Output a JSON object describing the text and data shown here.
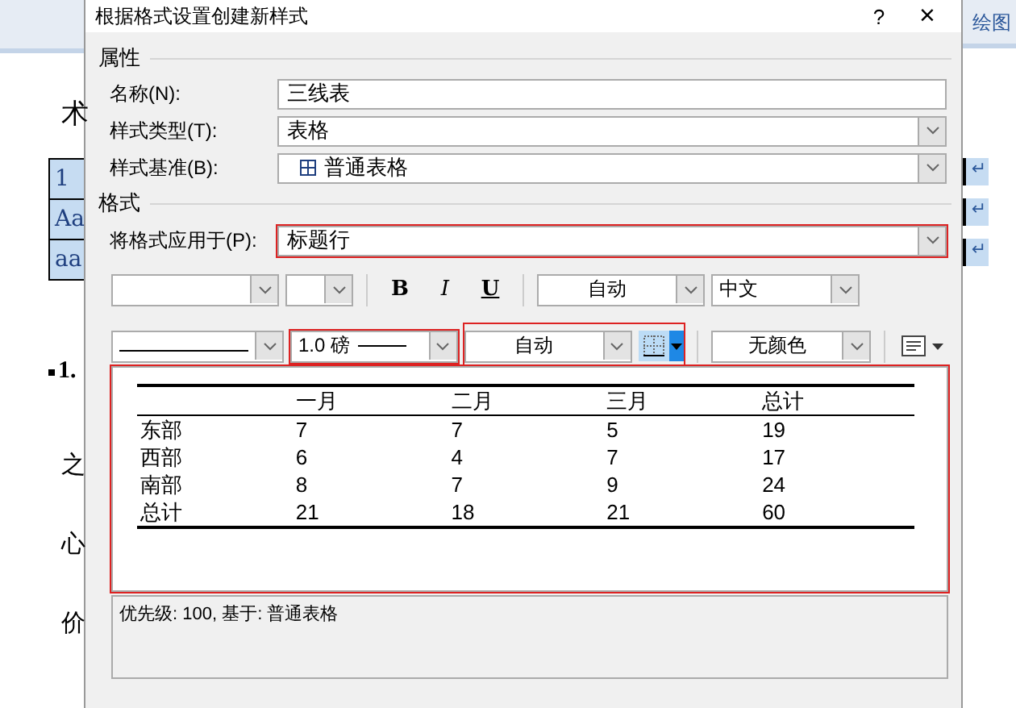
{
  "document": {
    "heading_char": "术",
    "table_cells": [
      "1",
      "Aa",
      "aa"
    ],
    "numbered_heading": "1.",
    "line_starts": [
      "之",
      "心",
      "价"
    ],
    "ribbon_tab": "绘图",
    "return_marks": [
      "↵",
      "↵",
      "↵"
    ]
  },
  "dialog": {
    "title": "根据格式设置创建新样式",
    "help": "?",
    "close": "×"
  },
  "properties": {
    "heading": "属性",
    "fields": [
      {
        "kind": "text",
        "label": "名称(N):",
        "value": "三线表"
      },
      {
        "kind": "combo",
        "label": "样式类型(T):",
        "value": "表格"
      },
      {
        "kind": "combo-icon",
        "label": "样式基准(B):",
        "value": "普通表格"
      }
    ]
  },
  "format": {
    "heading": "格式",
    "apply_to": {
      "label": "将格式应用于(P):",
      "value": "标题行",
      "highlighted": true
    },
    "toolbar_1": {
      "bold": "B",
      "italic": "I",
      "underline": "U",
      "font_color_setting": "自动",
      "script": "中文"
    },
    "toolbar_2": {
      "line_style_highlighted": false,
      "line_width": "1.0 磅",
      "line_width_highlighted": true,
      "line_color": "自动",
      "border_group_highlighted": true,
      "shading": "无颜色"
    },
    "preview": {
      "highlighted": true,
      "columns": [
        "",
        "一月",
        "二月",
        "三月",
        "总计"
      ],
      "rows": [
        [
          "东部",
          "7",
          "7",
          "5",
          "19"
        ],
        [
          "西部",
          "6",
          "4",
          "7",
          "17"
        ],
        [
          "南部",
          "8",
          "7",
          "9",
          "24"
        ],
        [
          "总计",
          "21",
          "18",
          "21",
          "60"
        ]
      ]
    },
    "description": "优先级: 100, 基于: 普通表格"
  }
}
